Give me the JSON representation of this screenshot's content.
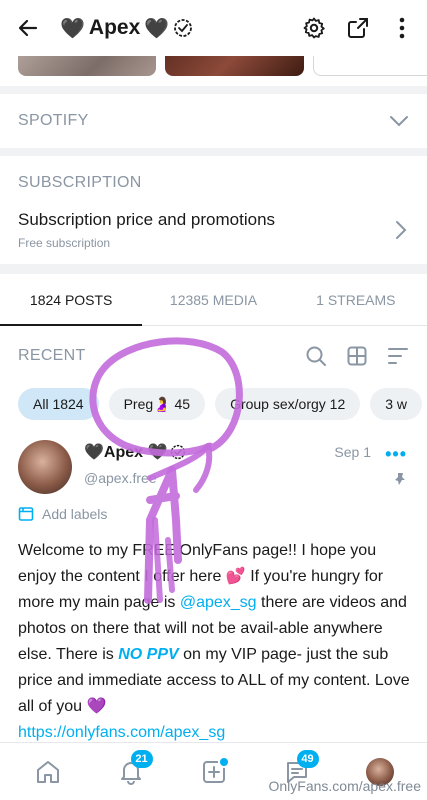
{
  "header": {
    "heart_left": "🖤",
    "title": "Apex",
    "heart_right": "🖤",
    "verified": "✔"
  },
  "spotify": {
    "label": "SPOTIFY"
  },
  "subscription": {
    "label": "SUBSCRIPTION",
    "title": "Subscription price and promotions",
    "note": "Free subscription"
  },
  "tabs": [
    {
      "label": "1824 POSTS"
    },
    {
      "label": "12385 MEDIA"
    },
    {
      "label": "1 STREAMS"
    }
  ],
  "recent": {
    "label": "RECENT"
  },
  "chips": [
    {
      "label": "All 1824"
    },
    {
      "label": "Preg🤰 45"
    },
    {
      "label": "Group sex/orgy 12"
    },
    {
      "label": "3 w"
    }
  ],
  "post": {
    "name": "🖤Apex 🖤",
    "handle": "@apex.free",
    "date": "Sep 1",
    "more": "•••",
    "add_labels": "Add labels",
    "text_1": "Welcome to my FREE OnlyFans page!! I hope you enjoy the content I offer here 💕 If you're hungry for more my main page is ",
    "mention": "@apex_sg",
    "text_2": " there are videos and photos on there that will not be avail-able anywhere else. There is ",
    "no_ppv": "NO PPV",
    "text_3": " on my VIP page- just the sub price and immediate access to ALL of my content. Love all of you 💜",
    "link": "https://onlyfans.com/apex_sg"
  },
  "nav": {
    "notifications_badge": "21",
    "messages_badge": "49"
  },
  "watermark": "OnlyFans.com/apex.free",
  "colors": {
    "accent": "#00aff0",
    "muted": "#8a96a3",
    "scribble": "#c36bdc"
  }
}
